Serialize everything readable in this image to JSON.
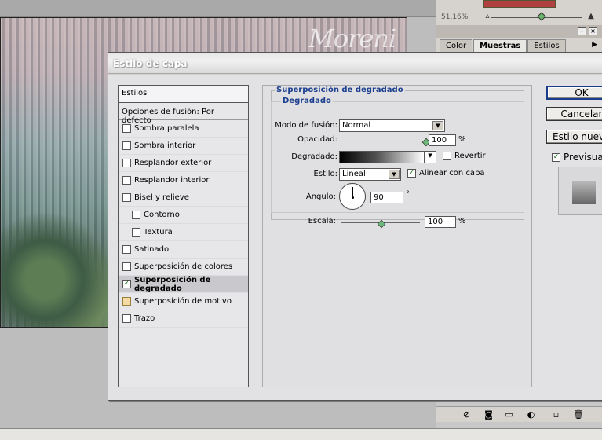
{
  "background": {
    "watermark": "Moreni"
  },
  "navigator": {
    "zoom": "51,16%",
    "zoom_slider_level": 0.52
  },
  "panel_tabs": [
    {
      "label": "Color",
      "active": false
    },
    {
      "label": "Muestras",
      "active": true
    },
    {
      "label": "Estilos",
      "active": false
    }
  ],
  "dialog": {
    "title": "Estilo de capa",
    "styles_header": "Estilos",
    "blend_options": "Opciones de fusión: Por defecto",
    "styles": [
      {
        "label": "Sombra paralela",
        "checked": false,
        "indent": false,
        "selected": false
      },
      {
        "label": "Sombra interior",
        "checked": false,
        "indent": false,
        "selected": false
      },
      {
        "label": "Resplandor exterior",
        "checked": false,
        "indent": false,
        "selected": false
      },
      {
        "label": "Resplandor interior",
        "checked": false,
        "indent": false,
        "selected": false
      },
      {
        "label": "Bisel y relieve",
        "checked": false,
        "indent": false,
        "selected": false
      },
      {
        "label": "Contorno",
        "checked": false,
        "indent": true,
        "selected": false
      },
      {
        "label": "Textura",
        "checked": false,
        "indent": true,
        "selected": false
      },
      {
        "label": "Satinado",
        "checked": false,
        "indent": false,
        "selected": false
      },
      {
        "label": "Superposición de colores",
        "checked": false,
        "indent": false,
        "selected": false
      },
      {
        "label": "Superposición de degradado",
        "checked": true,
        "indent": false,
        "selected": true
      },
      {
        "label": "Superposición de motivo",
        "checked": false,
        "indent": false,
        "selected": false,
        "yellow": true
      },
      {
        "label": "Trazo",
        "checked": false,
        "indent": false,
        "selected": false
      }
    ],
    "section_title": "Superposición de degradado",
    "subsection_title": "Degradado",
    "blend_mode": {
      "label": "Modo de fusión:",
      "value": "Normal"
    },
    "opacity": {
      "label": "Opacidad:",
      "value": "100",
      "unit": "%",
      "level": 1.0
    },
    "gradient": {
      "label": "Degradado:",
      "reverse_label": "Revertir",
      "reverse_checked": false
    },
    "style": {
      "label": "Estilo:",
      "value": "Lineal",
      "align_label": "Alinear con capa",
      "align_checked": true
    },
    "angle": {
      "label": "Ángulo:",
      "value": "90",
      "unit": "°"
    },
    "scale": {
      "label": "Escala:",
      "value": "100",
      "unit": "%",
      "level": 0.5
    },
    "buttons": {
      "ok": "OK",
      "cancel": "Cancelar",
      "new_style": "Estilo nuevo...",
      "preview": "Previsualizar",
      "preview_checked": true
    }
  }
}
